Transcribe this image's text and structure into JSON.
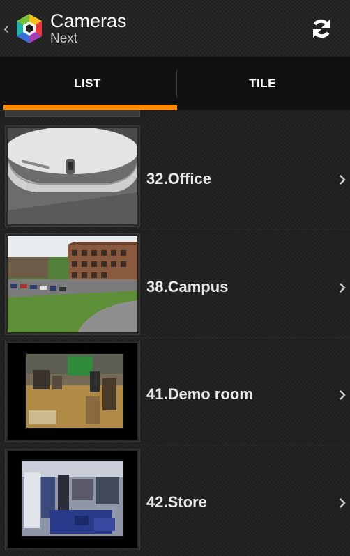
{
  "action_bar": {
    "title": "Cameras",
    "subtitle": "Next",
    "back_icon": "chevron-left-icon",
    "logo_icon": "app-logo-icon",
    "refresh_icon": "refresh-icon"
  },
  "tabs": [
    {
      "label": "LIST",
      "selected": true
    },
    {
      "label": "TILE",
      "selected": false
    }
  ],
  "colors": {
    "accent": "#ff8a00",
    "background": "#1f1f1f",
    "tab_bar": "#111111"
  },
  "cameras": [
    {
      "label": "32.Office",
      "thumbnail": "office-camera-thumbnail"
    },
    {
      "label": "38.Campus",
      "thumbnail": "campus-camera-thumbnail"
    },
    {
      "label": "41.Demo room",
      "thumbnail": "demo-room-camera-thumbnail"
    },
    {
      "label": "42.Store",
      "thumbnail": "store-camera-thumbnail"
    }
  ]
}
